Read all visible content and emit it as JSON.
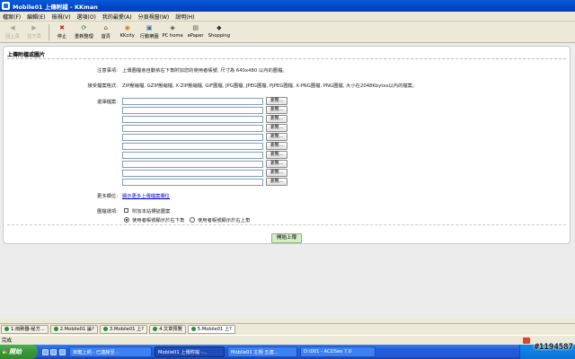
{
  "window": {
    "title": "Mobile01 上傳附檔 - KKman"
  },
  "menu": [
    "檔案(F)",
    "編輯(E)",
    "檢視(V)",
    "選項(O)",
    "我的最愛(A)",
    "分頁視窗(W)",
    "說明(H)"
  ],
  "toolbar": {
    "buttons": [
      {
        "label": "回上頁",
        "icon": "back-arrow-icon",
        "glyph": "◀",
        "disabled": true
      },
      {
        "label": "往下頁",
        "icon": "forward-arrow-icon",
        "glyph": "▶",
        "disabled": true
      },
      {
        "label": "停止",
        "icon": "stop-icon",
        "glyph": "✖",
        "disabled": false
      },
      {
        "label": "重新整理",
        "icon": "refresh-icon",
        "glyph": "⟳",
        "disabled": false
      },
      {
        "label": "首頁",
        "icon": "home-icon",
        "glyph": "⌂",
        "disabled": false
      },
      {
        "label": "KKcity",
        "icon": "kkcity-icon",
        "glyph": "◉",
        "disabled": false
      },
      {
        "label": "行動樂園",
        "icon": "mobile-park-icon",
        "glyph": "▣",
        "disabled": false
      },
      {
        "label": "PC home",
        "icon": "pchome-icon",
        "glyph": "◈",
        "disabled": false
      },
      {
        "label": "ePaper",
        "icon": "epaper-icon",
        "glyph": "▤",
        "disabled": false
      },
      {
        "label": "Shopping",
        "icon": "shopping-icon",
        "glyph": "◆",
        "disabled": false
      }
    ]
  },
  "panel": {
    "title": "上傳附檔或圖片",
    "notice_label": "注意事項:",
    "notice_text": "上傳圖檔會自動依右下角附加您的使用者帳號, 尺寸為 640x480 以內的圖檔。",
    "formats_label": "接受檔案格式:",
    "formats_text": "ZIP壓縮檔, GZIP壓縮檔, X-ZIP壓縮檔, GIF圖檔, JPG圖檔, JPEG圖檔, PJPEG圖檔, X-PNG圖檔, PNG圖檔, 大小在2048Kbytes以內的檔案。",
    "select_label": "選擇檔案:",
    "browse_label": "瀏覽...",
    "file_count": 10,
    "more_label": "更多欄位:",
    "more_link": "顯示更多上傳檔案欄位",
    "options_label": "圖檔選項:",
    "opt_watermark": "附加本站標誌圖案",
    "opt_bottom_right": "使用者帳號顯示於右下角",
    "opt_top_right": "使用者帳號顯示於右上角",
    "upload_button": "開始上傳"
  },
  "tabs": [
    {
      "label": "1.雨刷器-秘方..."
    },
    {
      "label": "2.Mobile01 論?"
    },
    {
      "label": "3.Mobile01 上?"
    },
    {
      "label": "4.文章預覽"
    },
    {
      "label": "5.Mobile01 上?"
    }
  ],
  "status": {
    "text": "完成"
  },
  "taskbar": {
    "start_label": "開始",
    "buttons": [
      "家鍵上網 - 已連線至...",
      "Mobile01 上傳附檔 -...",
      "Mobile01 主題 五連...",
      "D:\\001 - ACDSee 7.0"
    ]
  },
  "watermark": "#1194587"
}
